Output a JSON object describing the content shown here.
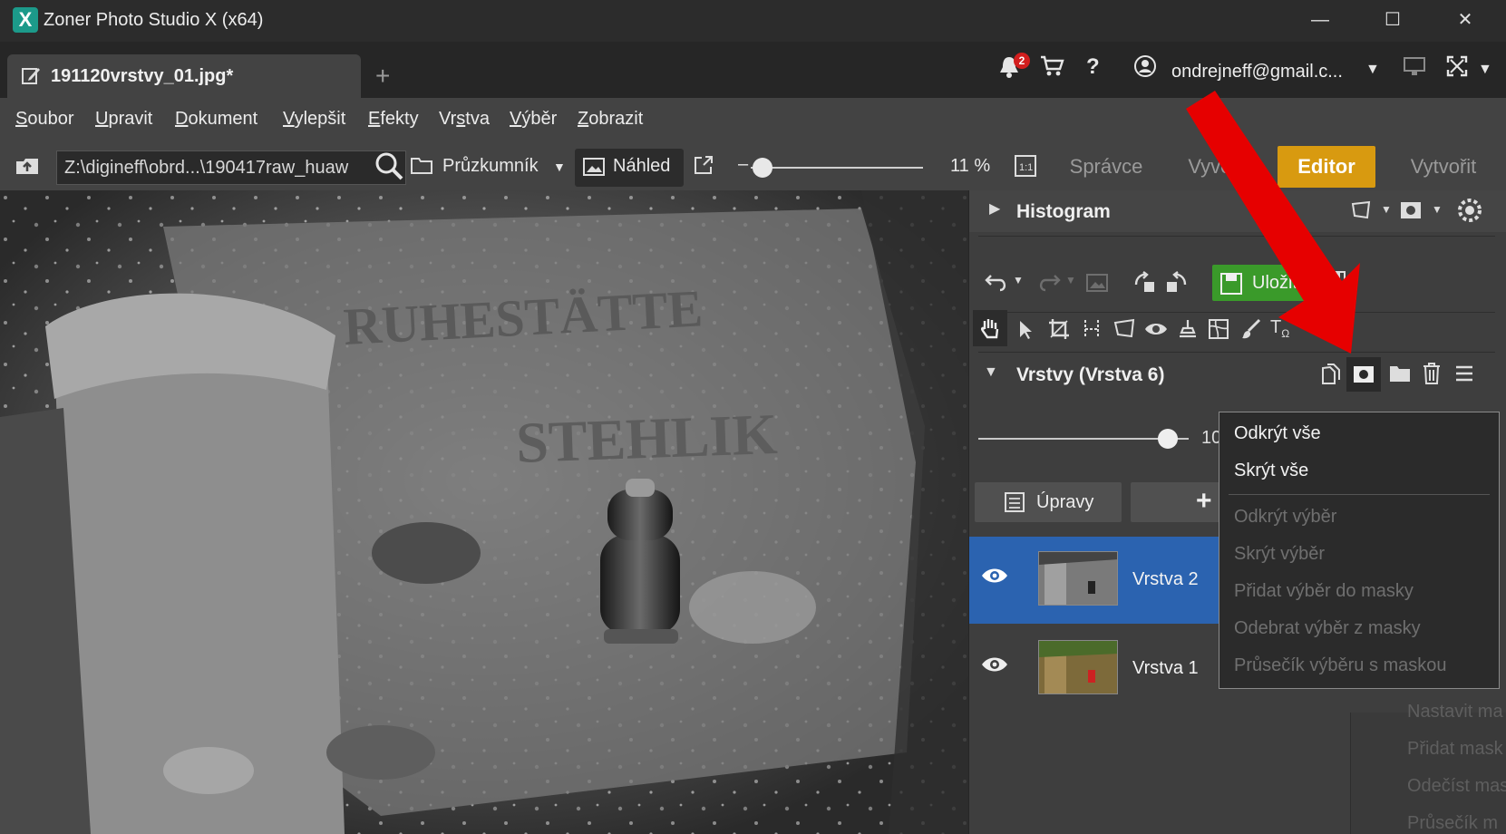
{
  "window": {
    "title": "Zoner Photo Studio X (x64)",
    "minimize": "—",
    "maximize": "☐",
    "close": "✕"
  },
  "tabbar": {
    "document_tab": "191120vrstvy_01.jpg*",
    "new_tab": "+",
    "notification_count": "2",
    "account": "ondrejneff@gmail.c..."
  },
  "menu": [
    "Soubor",
    "Upravit",
    "Dokument",
    "Vylepšit",
    "Efekty",
    "Vrstva",
    "Výběr",
    "Zobrazit"
  ],
  "toolbar": {
    "path": "Z:\\digineff\\obrd...\\190417raw_huaw",
    "explorer_label": "Průzkumník",
    "preview_label": "Náhled",
    "zoom_value": "11 %",
    "zoom_fraction": 0.07,
    "modes": [
      "Správce",
      "Vyvolat",
      "Editor",
      "Vytvořit"
    ],
    "active_mode": "Editor"
  },
  "panel": {
    "histogram_title": "Histogram",
    "save_label": "Uložit",
    "layers_title": "Vrstvy (Vrstva 6)",
    "opacity_value": "10",
    "opacity_fraction": 0.9,
    "adjust_label": "Úpravy",
    "add_label": "+",
    "layers": [
      {
        "name": "Vrstva 2",
        "selected": true
      },
      {
        "name": "Vrstva 1",
        "selected": false
      }
    ]
  },
  "dropdown": {
    "items": [
      {
        "label": "Odkrýt vše",
        "enabled": true
      },
      {
        "label": "Skrýt vše",
        "enabled": true
      },
      {
        "label": "Odkrýt výběr",
        "enabled": false
      },
      {
        "label": "Skrýt výběr",
        "enabled": false
      },
      {
        "label": "Přidat výběr do masky",
        "enabled": false
      },
      {
        "label": "Odebrat výběr z masky",
        "enabled": false
      },
      {
        "label": "Průsečík výběru s maskou",
        "enabled": false
      }
    ]
  },
  "background_menu": [
    "Nastavit ma",
    "Přidat mask",
    "Odečíst mas",
    "Průsečík m"
  ],
  "colors": {
    "accent_editor": "#d89a10",
    "save_green": "#3a9a2a",
    "selected_layer": "#2b63b0",
    "annotation_arrow": "#e60000",
    "badge_red": "#d21e1e"
  }
}
